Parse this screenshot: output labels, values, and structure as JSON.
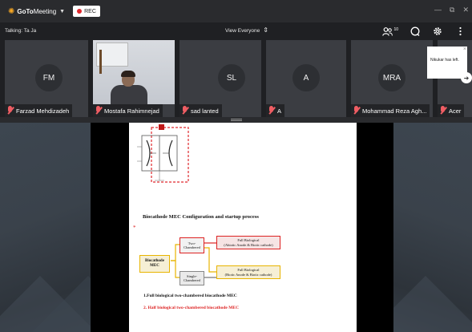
{
  "app": {
    "brand_goto": "GoTo",
    "brand_meeting": "Meeting",
    "rec_label": "REC",
    "window_controls": [
      "—",
      "⧉",
      "✕"
    ]
  },
  "subbar": {
    "talking": "Talking: Ta Ja",
    "view": "View Everyone",
    "people_count": "10"
  },
  "participants": [
    {
      "initials": "FM",
      "name": "Farzad Mehdizadeh",
      "muted": true
    },
    {
      "initials": "",
      "name": "Mostafa Rahimnejad",
      "muted": false,
      "video": true
    },
    {
      "initials": "SL",
      "name": "sad lanted",
      "muted": true
    },
    {
      "initials": "A",
      "name": "A",
      "muted": true
    },
    {
      "initials": "MRA",
      "name": "Mohammad Reza Agh...",
      "muted": true
    },
    {
      "initials": "",
      "name": "Acer",
      "muted": true
    }
  ],
  "notification": {
    "text": "Nikukar has left."
  },
  "slide": {
    "heading": "Biocathode MEC Configuration and startup process",
    "star": "*",
    "diagram": {
      "root": "Biocathode MEC",
      "two_chambered": "Two-Chambered",
      "single_chambered": "Single-Chambered",
      "full_bio_top": "Full Biological",
      "full_bio_top_sub": "(Abiotic Anode & Biotic cathode)",
      "full_bio_bottom": "Full Biological",
      "full_bio_bottom_sub": "(Biotic Anode & Biotic cathode)"
    },
    "item1": "1.Full biological two-chambered biocathode MEC",
    "item2": "2. Half biological two-chambered biocathode MEC"
  },
  "colors": {
    "accent_red": "#e0282d",
    "brand_orange": "#f5a623",
    "muted_mic": "#ef5d63",
    "diagram_red": "#d22",
    "diagram_yellow": "#e8b400"
  }
}
